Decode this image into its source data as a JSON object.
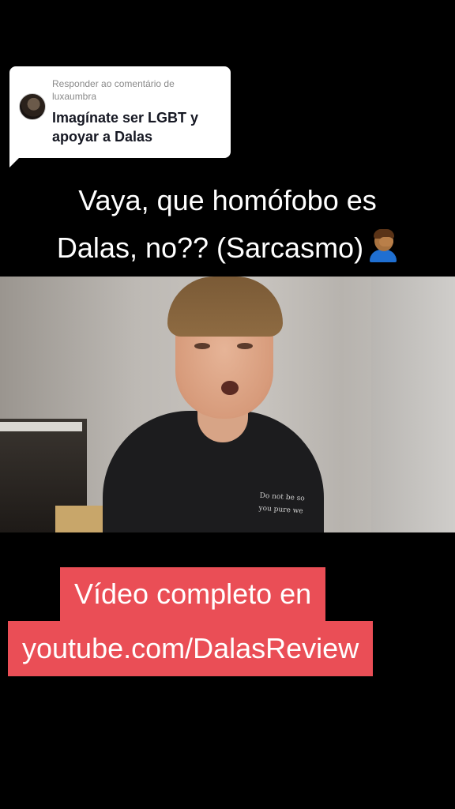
{
  "reply": {
    "label": "Responder ao comentário de luxaumbra",
    "comment": "Imagínate ser LGBT y apoyar a Dalas"
  },
  "caption": {
    "line1": "Vaya, que homófobo es",
    "line2": "Dalas, no?? (Sarcasmo)",
    "emoji": "facepalm-man-icon"
  },
  "video": {
    "shirt_text_line1": "Do not be so",
    "shirt_text_line2": "you pure we"
  },
  "cta": {
    "line1": "Vídeo completo en",
    "line2": "youtube.com/DalasReview",
    "color": "#ea4e56"
  }
}
